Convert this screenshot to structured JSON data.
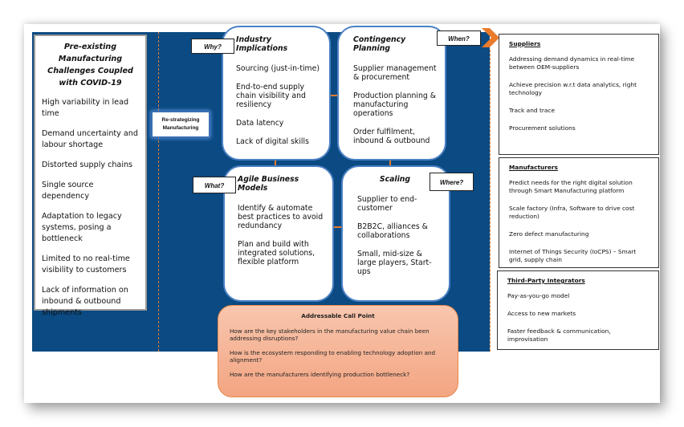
{
  "colors": {
    "band_blue": "#0b4a82",
    "accent_orange": "#e87b2c",
    "bubble_border": "#4a80c4",
    "callpoint_fill": "#f3a582"
  },
  "challenges": {
    "title": "Pre-existing Manufacturing Challenges Coupled with COVID-19",
    "items": [
      "High variability in lead time",
      "Demand uncertainty and labour shortage",
      "Distorted supply chains",
      "Single source dependency",
      "Adaptation to legacy systems, posing a bottleneck",
      "Limited to no real-time visibility to customers",
      "Lack of information on inbound & outbound shipments"
    ]
  },
  "center_label": "Re-strategizing Manufacturing",
  "tags": {
    "why": "Why?",
    "when": "When?",
    "what": "What?",
    "where": "Where?"
  },
  "quadrants": {
    "industry": {
      "title": "Industry Implications",
      "items": [
        "Sourcing (just-in-time)",
        "End-to-end supply chain visibility and resiliency",
        "Data latency",
        "Lack of digital skills"
      ]
    },
    "contingency": {
      "title": "Contingency Planning",
      "items": [
        "Supplier management & procurement",
        "Production planning & manufacturing operations",
        "Order fulfilment, inbound & outbound"
      ]
    },
    "agile": {
      "title": "Agile Business Models",
      "items": [
        "Identify & automate best practices to avoid redundancy",
        "Plan and build with integrated solutions, flexible platform"
      ]
    },
    "scaling": {
      "title": "Scaling",
      "items": [
        "Supplier to end-customer",
        "B2B2C, alliances & collaborations",
        "Small, mid-size & large players, Start-ups"
      ]
    }
  },
  "stakeholders": {
    "suppliers": {
      "title": "Suppliers",
      "items": [
        "Addressing demand dynamics in real-time between OEM-suppliers",
        "Achieve precision w.r.t data analytics, right technology",
        "Track and trace",
        "Procurement solutions"
      ]
    },
    "manufacturers": {
      "title": "Manufacturers",
      "items": [
        "Predict needs for the right digital solution through Smart Manufacturing platform",
        "Scale factory (Infra, Software to drive cost reduction)",
        "Zero defect manufacturing",
        "Internet of Things Security (IoCPS) – Smart grid, supply chain"
      ]
    },
    "integrators": {
      "title": "Third-Party Integrators",
      "items": [
        "Pay-as-you-go model",
        "Access to new markets",
        "Faster feedback & communication, improvisation"
      ]
    }
  },
  "callpoint": {
    "title": "Addressable Call Point",
    "items": [
      "How are the key stakeholders in the manufacturing value chain been addressing disruptions?",
      "How is the ecosystem responding to enabling technology adoption and alignment?",
      "How are the manufacturers identifying production bottleneck?"
    ]
  }
}
